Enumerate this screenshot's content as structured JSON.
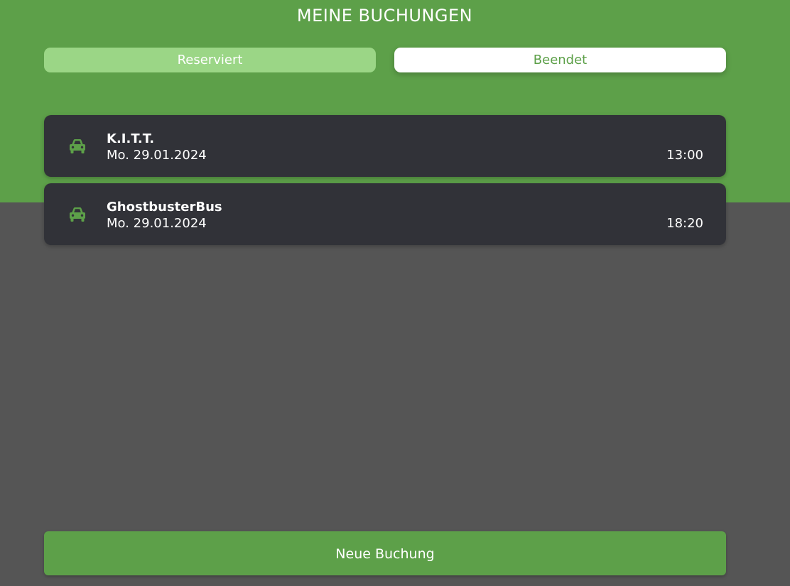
{
  "header": {
    "title": "MEINE BUCHUNGEN"
  },
  "tabs": [
    {
      "label": "Reserviert",
      "active": false
    },
    {
      "label": "Beendet",
      "active": true
    }
  ],
  "bookings": [
    {
      "icon": "car-icon",
      "name": "K.I.T.T.",
      "date": "Mo. 29.01.2024",
      "time": "13:00"
    },
    {
      "icon": "car-icon",
      "name": "GhostbusterBus",
      "date": "Mo. 29.01.2024",
      "time": "18:20"
    }
  ],
  "footer": {
    "new_booking_label": "Neue Buchung"
  },
  "colors": {
    "brand_green": "#5da049",
    "light_green": "#9bd686",
    "card_bg": "#313238",
    "page_bg": "#555555"
  }
}
